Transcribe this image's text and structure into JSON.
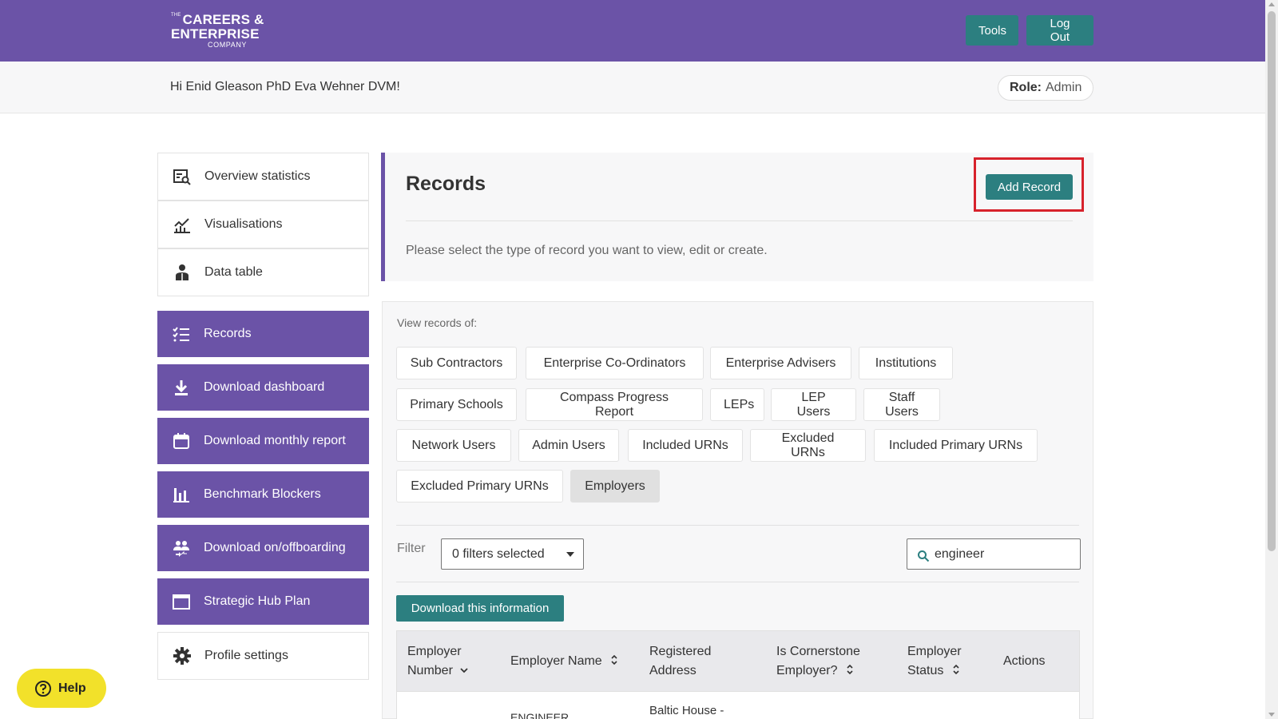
{
  "header": {
    "logo": {
      "line1_small": "THE",
      "line1": "CAREERS &",
      "line2": "ENTERPRISE",
      "line3": "COMPANY"
    },
    "tools_label": "Tools",
    "logout_label": "Log Out"
  },
  "subheader": {
    "greeting": "Hi Enid Gleason PhD Eva Wehner DVM!",
    "role_label": "Role:",
    "role_value": "Admin"
  },
  "sidebar": {
    "top_items": [
      {
        "label": "Overview statistics",
        "icon": "overview-statistics-icon"
      },
      {
        "label": "Visualisations",
        "icon": "visualisations-icon"
      },
      {
        "label": "Data table",
        "icon": "data-table-icon"
      }
    ],
    "purple_items": [
      {
        "label": "Records",
        "icon": "records-list-icon"
      },
      {
        "label": "Download dashboard",
        "icon": "download-icon"
      },
      {
        "label": "Download monthly report",
        "icon": "calendar-icon"
      },
      {
        "label": "Benchmark Blockers",
        "icon": "bar-chart-icon"
      },
      {
        "label": "Download on/offboarding",
        "icon": "users-icon"
      },
      {
        "label": "Strategic Hub Plan",
        "icon": "folder-icon"
      }
    ],
    "bottom_item": {
      "label": "Profile settings",
      "icon": "gear-icon"
    }
  },
  "records": {
    "title": "Records",
    "add_label": "Add Record",
    "subtitle": "Please select the type of record you want to view, edit or create."
  },
  "types": {
    "view_label": "View records of:",
    "items": [
      "Sub Contractors",
      "Enterprise Co-Ordinators",
      "Enterprise Advisers",
      "Institutions",
      "Primary Schools",
      "Compass Progress Report",
      "LEPs",
      "LEP Users",
      "Staff Users",
      "Network Users",
      "Admin Users",
      "Included URNs",
      "Excluded URNs",
      "Included Primary URNs",
      "Excluded Primary URNs",
      "Employers"
    ],
    "active": "Employers"
  },
  "filters": {
    "label": "Filter",
    "selected": "0 filters selected",
    "search_value": "engineer"
  },
  "download_label": "Download this information",
  "table": {
    "columns": [
      {
        "line1": "Employer",
        "line2": "Number",
        "sort": "chevron-down-icon"
      },
      {
        "line1": "Employer Name",
        "line2": "",
        "sort": "sort-icon"
      },
      {
        "line1": "Registered",
        "line2": "Address",
        "sort": ""
      },
      {
        "line1": "Is Cornerstone",
        "line2": "Employer?",
        "sort": "sort-icon"
      },
      {
        "line1": "Employer",
        "line2": "Status",
        "sort": "sort-icon"
      },
      {
        "line1": "Actions",
        "line2": "",
        "sort": ""
      }
    ],
    "rows": [
      {
        "employer_name": "ENGINEER...",
        "registered_address": "Baltic House -"
      }
    ]
  },
  "help_label": "Help",
  "colors": {
    "brand_purple": "#6b53a7",
    "teal_button": "#2c7f80",
    "highlight_red": "#d7222c",
    "help_yellow": "#f2e12a"
  }
}
